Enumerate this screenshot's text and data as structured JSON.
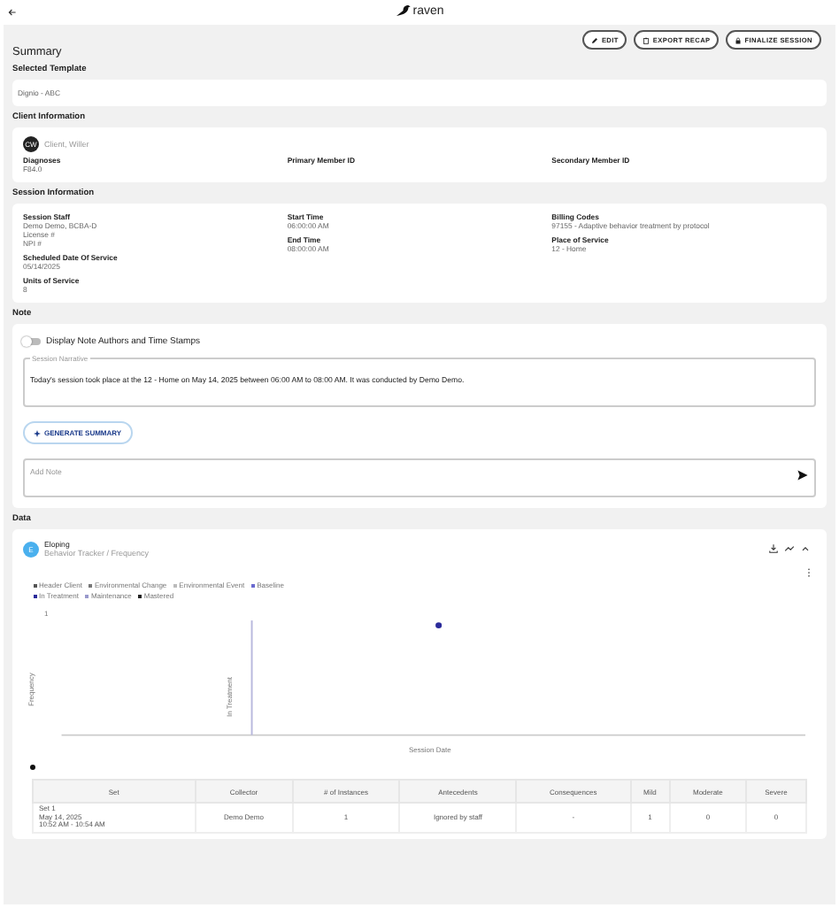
{
  "header": {
    "logo": "raven"
  },
  "actions": [
    {
      "label": "EDIT",
      "kind": "edit"
    },
    {
      "label": "EXPORT RECAP",
      "kind": "export"
    },
    {
      "label": "FINALIZE SESSION",
      "kind": "finalize"
    }
  ],
  "summary": {
    "title": "Summary",
    "template_heading": "Selected Template",
    "template": "Dignio - ABC"
  },
  "client": {
    "heading": "Client Information",
    "initials": "CW",
    "name": "Client, Willer",
    "fields": [
      {
        "label": "Diagnoses",
        "value": "F84.0"
      },
      {
        "label": "Primary Member ID"
      },
      {
        "label": "Secondary Member ID"
      }
    ]
  },
  "session": {
    "heading": "Session Information",
    "columns": [
      [
        {
          "label": "Session Staff",
          "lines": [
            "Demo Demo, BCBA-D",
            "License #",
            "NPI #"
          ]
        },
        {
          "label": "Scheduled Date Of Service",
          "lines": [
            "05/14/2025"
          ]
        },
        {
          "label": "Units of Service",
          "lines": [
            "8"
          ]
        }
      ],
      [
        {
          "label": "Start Time",
          "lines": [
            "06:00:00 AM"
          ]
        },
        {
          "label": "End Time",
          "lines": [
            "08:00:00 AM"
          ]
        }
      ],
      [
        {
          "label": "Billing Codes",
          "lines": [
            "97155 - Adaptive behavior treatment by protocol"
          ]
        },
        {
          "label": "Place of Service",
          "lines": [
            "12 - Home"
          ]
        }
      ]
    ]
  },
  "note": {
    "heading": "Note",
    "toggle": {
      "label": "Display Note Authors and Time Stamps",
      "on": false
    },
    "narrative_label": "Session Narrative",
    "narrative": "Today's  session took place at the 12 - Home on May 14, 2025 between 06:00 AM to 08:00 AM. It was conducted by Demo Demo.",
    "generate": "GENERATE SUMMARY",
    "add_note_placeholder": "Add Note"
  },
  "data": {
    "heading": "Data",
    "behavior": {
      "initial": "E",
      "name": "Eloping",
      "subtitle": "Behavior Tracker / Frequency"
    },
    "legend": [
      {
        "label": "Header Client",
        "color": "#555555"
      },
      {
        "label": "Environmental Change",
        "color": "#777777"
      },
      {
        "label": "Environmental Event",
        "color": "#bbbbbb"
      },
      {
        "label": "Baseline",
        "color": "#6a6ad0"
      },
      {
        "label": "In Treatment",
        "color": "#2a2a9a"
      },
      {
        "label": "Maintenance",
        "color": "#9999cc"
      },
      {
        "label": "Mastered",
        "color": "#222222"
      }
    ],
    "chart": {
      "ytick": "1",
      "ylabel": "Frequency",
      "phase_label": "In Treatment",
      "xlabel": "Session Date"
    },
    "table": {
      "columns": [
        "Set",
        "Collector",
        "# of Instances",
        "Antecedents",
        "Consequences",
        "Mild",
        "Moderate",
        "Severe"
      ],
      "rows": [
        [
          [
            "Set 1",
            "May 14, 2025",
            "10:52 AM - 10:54 AM"
          ],
          [
            "Demo Demo"
          ],
          [
            "1"
          ],
          [
            "Ignored by staff"
          ],
          [
            "-"
          ],
          [
            "1"
          ],
          [
            "0"
          ],
          [
            "0"
          ]
        ]
      ]
    }
  }
}
